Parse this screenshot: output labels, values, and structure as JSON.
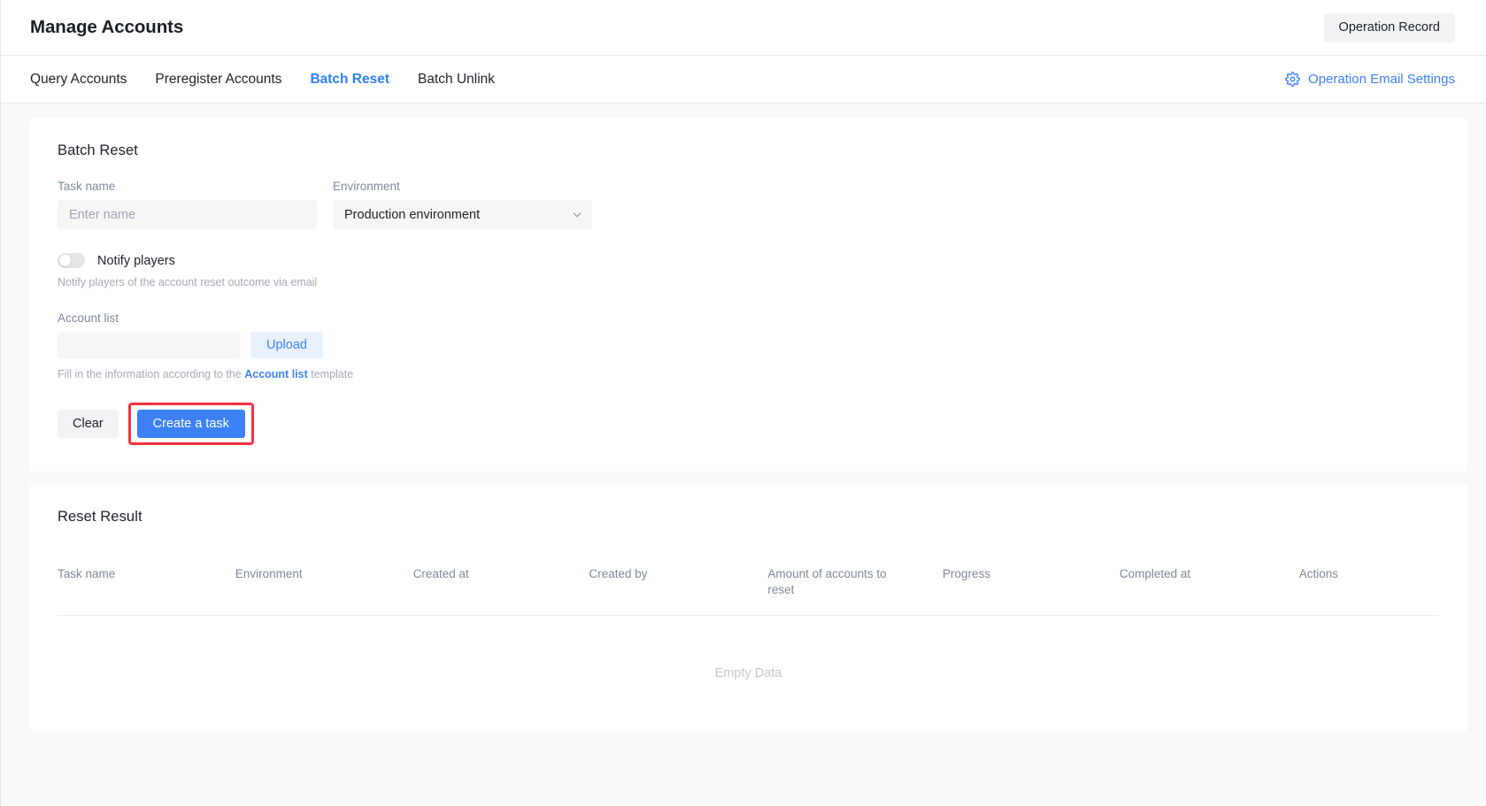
{
  "header": {
    "title": "Manage Accounts",
    "operation_record_label": "Operation Record"
  },
  "tabs": [
    {
      "label": "Query Accounts",
      "active": false
    },
    {
      "label": "Preregister Accounts",
      "active": false
    },
    {
      "label": "Batch Reset",
      "active": true
    },
    {
      "label": "Batch Unlink",
      "active": false
    }
  ],
  "email_settings": {
    "label": "Operation Email Settings",
    "icon": "gear-icon",
    "color": "#3c82f6"
  },
  "batch_reset": {
    "card_title": "Batch Reset",
    "task_name": {
      "label": "Task name",
      "value": "",
      "placeholder": "Enter name"
    },
    "environment": {
      "label": "Environment",
      "selected": "Production environment",
      "options": [
        "Production environment"
      ],
      "icon": "chevron-down-icon"
    },
    "notify_players": {
      "label": "Notify players",
      "hint": "Notify players of the account reset outcome via email",
      "enabled": false
    },
    "account_list": {
      "label": "Account list",
      "value": "",
      "placeholder": "",
      "upload_label": "Upload",
      "hint_prefix": "Fill in the information according to the ",
      "hint_link": "Account list",
      "hint_suffix": " template"
    },
    "actions": {
      "clear_label": "Clear",
      "create_label": "Create a task",
      "highlight_color": "#f5333f",
      "primary_color": "#3c82f6"
    }
  },
  "reset_result": {
    "card_title": "Reset Result",
    "columns": [
      "Task name",
      "Environment",
      "Created at",
      "Created by",
      "Amount of accounts to reset",
      "Progress",
      "Completed at",
      "Actions"
    ],
    "rows": [],
    "empty_text": "Empty Data"
  }
}
